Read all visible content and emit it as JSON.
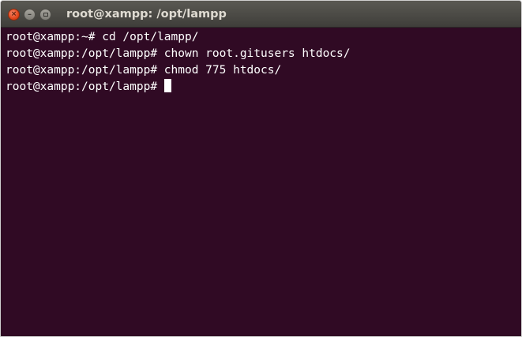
{
  "window": {
    "title": "root@xampp: /opt/lampp",
    "controls": {
      "close_icon": "close-icon",
      "close_glyph": "×",
      "minimize_icon": "minimize-icon",
      "minimize_glyph": "–",
      "maximize_icon": "maximize-icon"
    }
  },
  "terminal": {
    "colors": {
      "background": "#300a24",
      "text": "#ffffff",
      "titlebar": "#4a4945"
    },
    "lines": [
      {
        "prompt": "root@xampp:~# ",
        "command": "cd /opt/lampp/"
      },
      {
        "prompt": "root@xampp:/opt/lampp# ",
        "command": "chown root.gitusers htdocs/"
      },
      {
        "prompt": "root@xampp:/opt/lampp# ",
        "command": "chmod 775 htdocs/"
      },
      {
        "prompt": "root@xampp:/opt/lampp# ",
        "command": ""
      }
    ]
  }
}
